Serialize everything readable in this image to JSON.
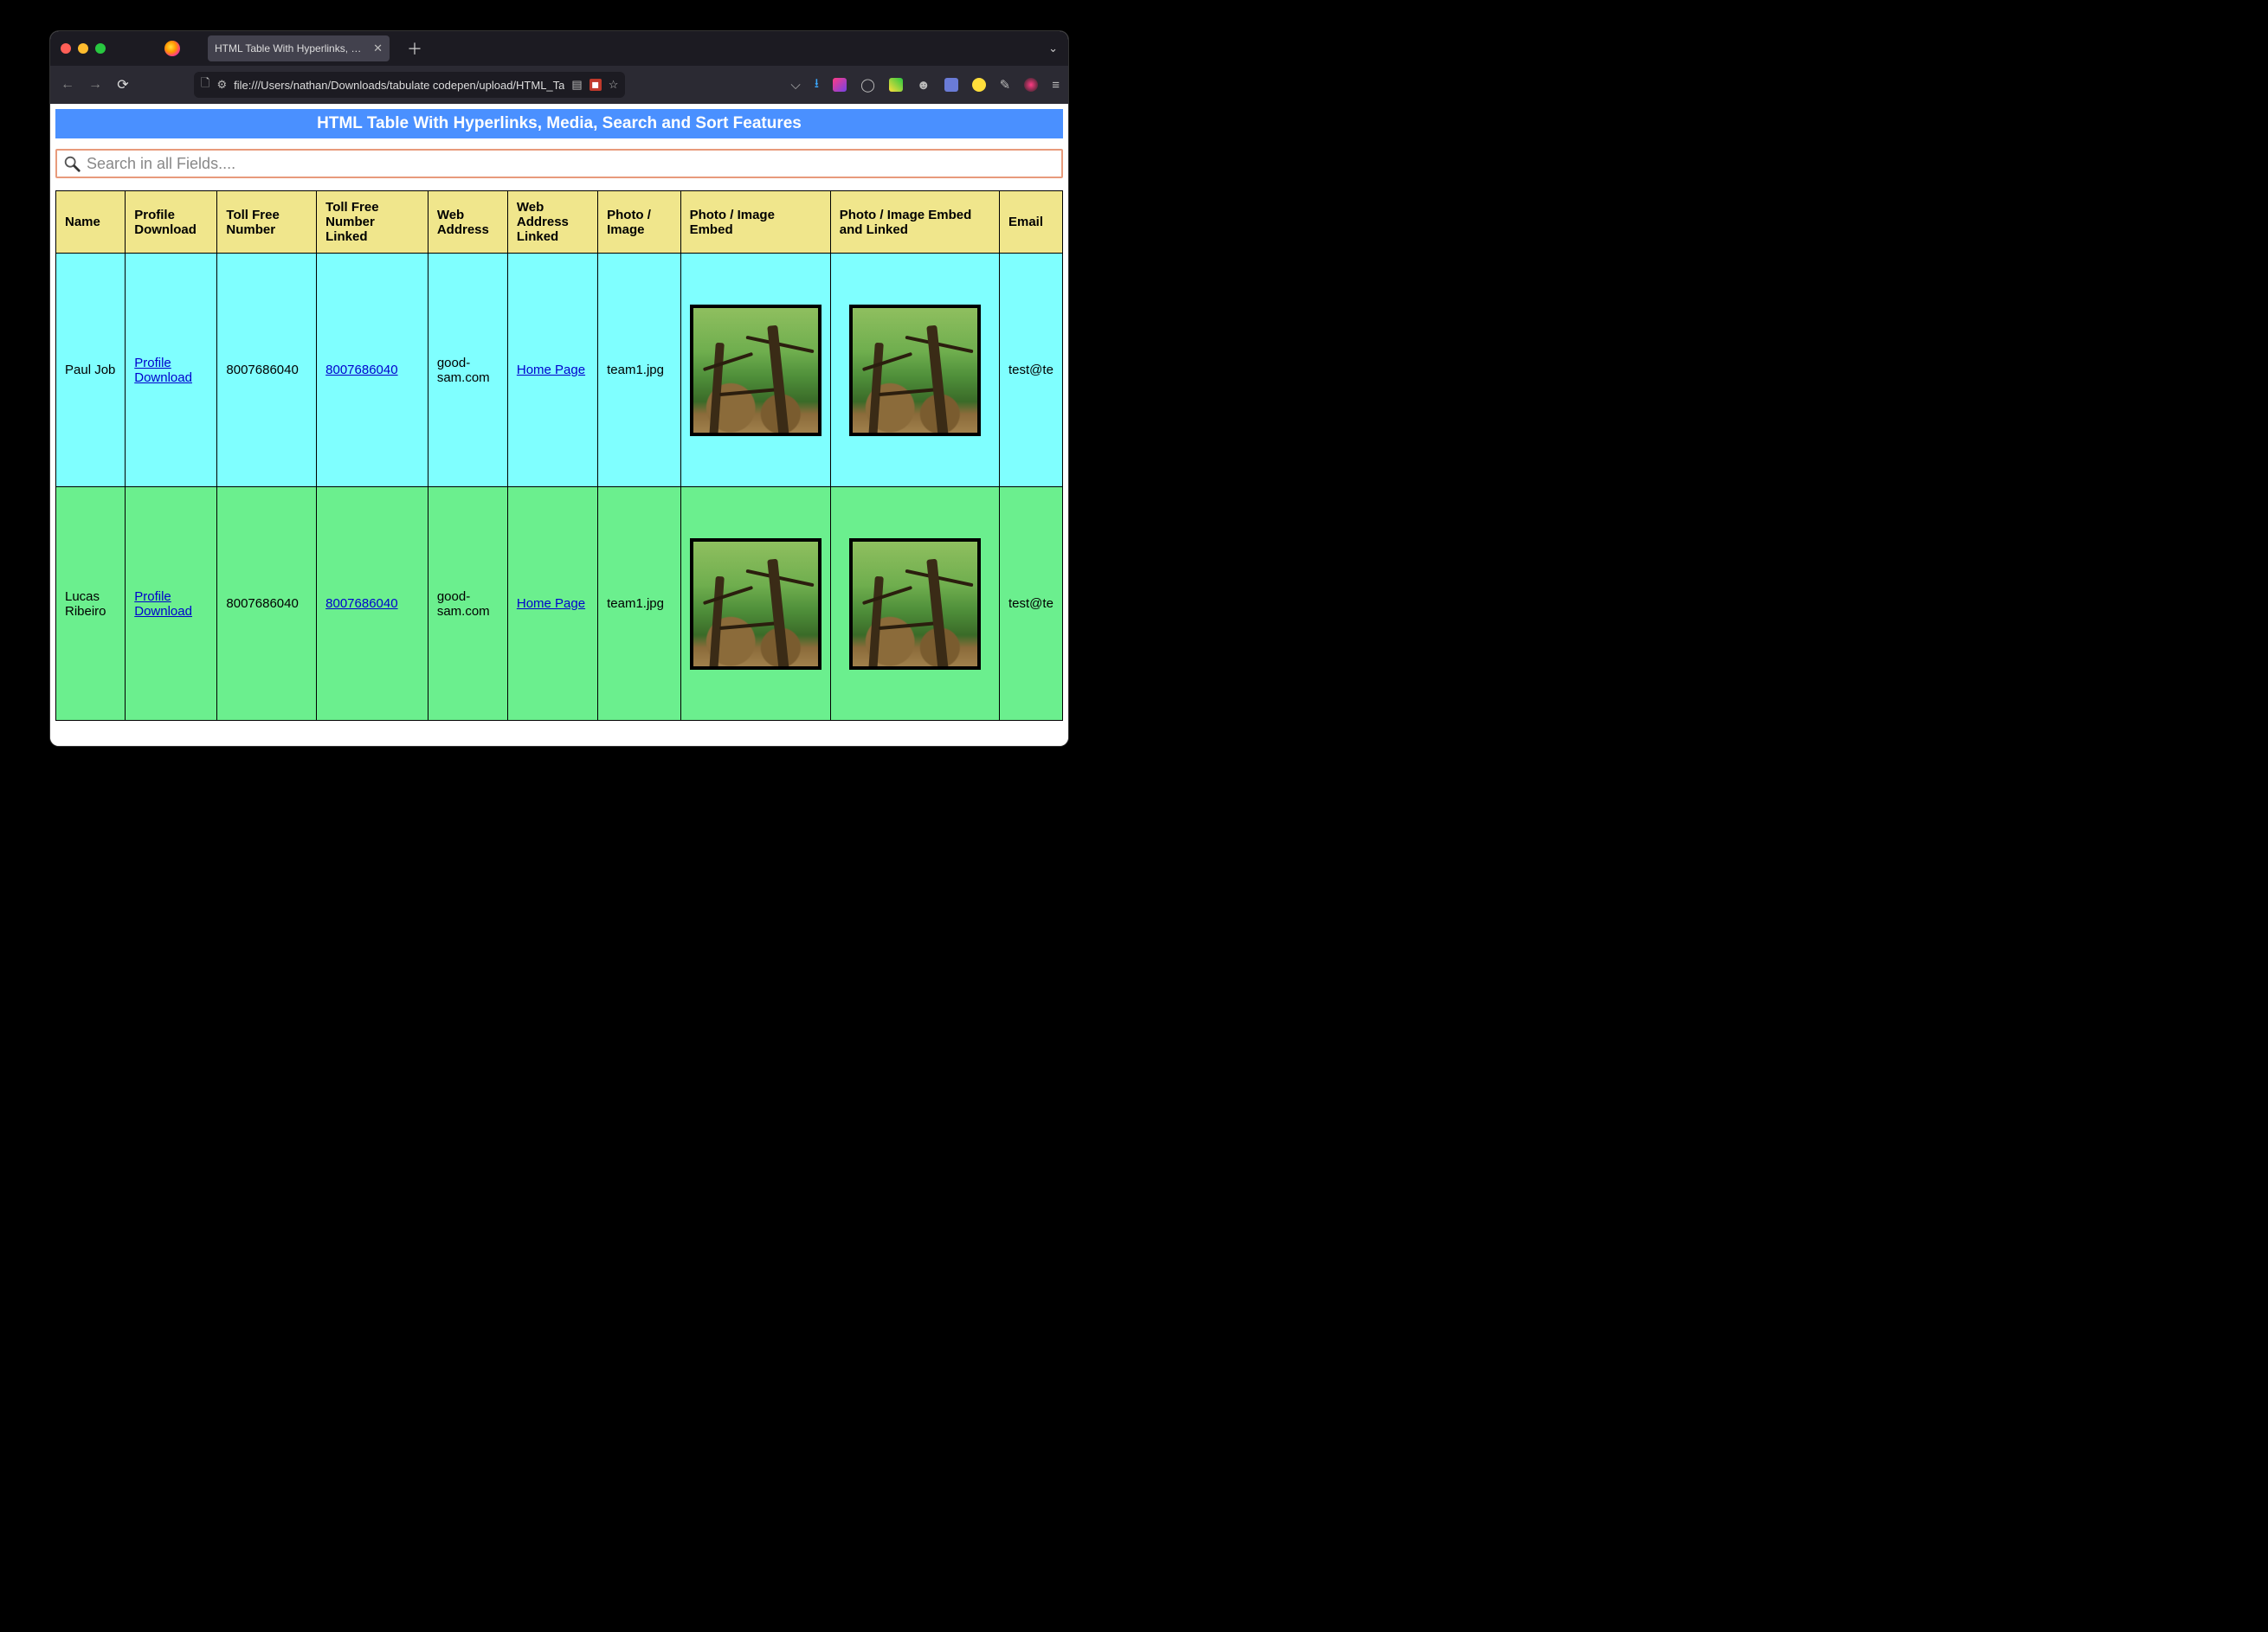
{
  "browser": {
    "tab_title": "HTML Table With Hyperlinks, Media,",
    "url": "file:///Users/nathan/Downloads/tabulate codepen/upload/HTML_Ta"
  },
  "page": {
    "title": "HTML Table With Hyperlinks, Media, Search and Sort Features",
    "search_placeholder": "Search in all Fields....",
    "columns": [
      "Name",
      "Profile Download",
      "Toll Free Number",
      "Toll Free Number Linked",
      "Web Address",
      "Web Address Linked",
      "Photo / Image",
      "Photo / Image Embed",
      "Photo / Image Embed and Linked",
      "Email"
    ],
    "rows": [
      {
        "name": "Paul Job",
        "profile_download": "Profile Download",
        "toll_free": "8007686040",
        "toll_free_linked": "8007686040",
        "web_address": "good-sam.com",
        "web_address_linked": "Home Page",
        "photo": "team1.jpg",
        "email": "test@te"
      },
      {
        "name": "Lucas Ribeiro",
        "profile_download": "Profile Download",
        "toll_free": "8007686040",
        "toll_free_linked": "8007686040",
        "web_address": "good-sam.com",
        "web_address_linked": "Home Page",
        "photo": "team1.jpg",
        "email": "test@te"
      }
    ]
  }
}
